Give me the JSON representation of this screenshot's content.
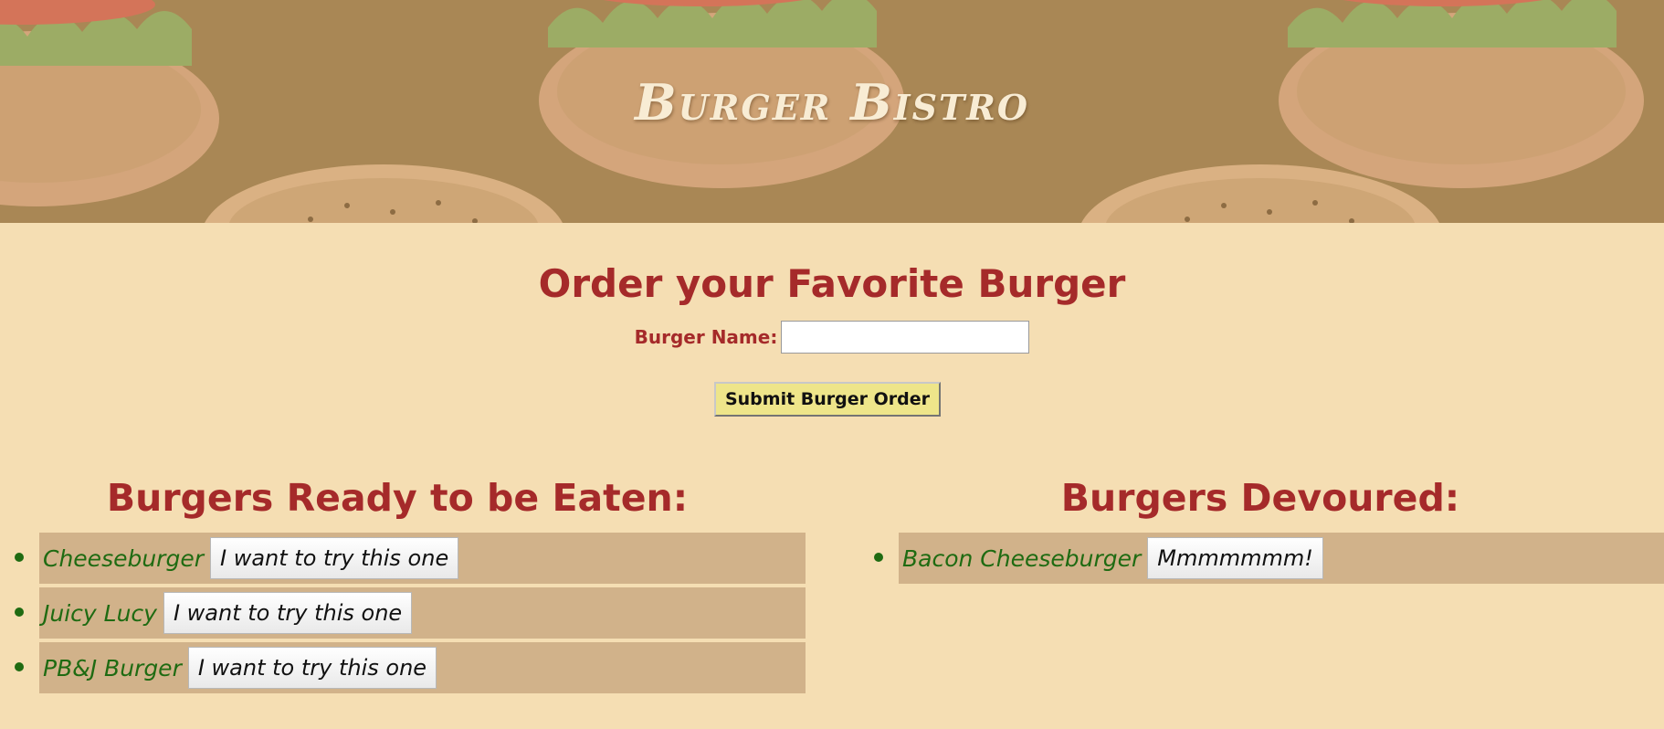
{
  "header": {
    "title": "Burger Bistro"
  },
  "order_form": {
    "heading": "Order your Favorite Burger",
    "label": "Burger Name:",
    "input_value": "",
    "submit_label": "Submit Burger Order"
  },
  "ready": {
    "heading": "Burgers Ready to be Eaten:",
    "items": [
      {
        "name": "Cheeseburger",
        "button": "I want to try this one"
      },
      {
        "name": "Juicy Lucy",
        "button": "I want to try this one"
      },
      {
        "name": "PB&J Burger",
        "button": "I want to try this one"
      }
    ]
  },
  "devoured": {
    "heading": "Burgers Devoured:",
    "items": [
      {
        "name": "Bacon Cheeseburger",
        "button": "Mmmmmmm!"
      }
    ]
  },
  "colors": {
    "page_background": "#f5deb3",
    "heading": "#a52a2a",
    "burger_name": "#1f6b12",
    "list_item_background": "#d1b28a",
    "submit_button": "#eee58a"
  }
}
